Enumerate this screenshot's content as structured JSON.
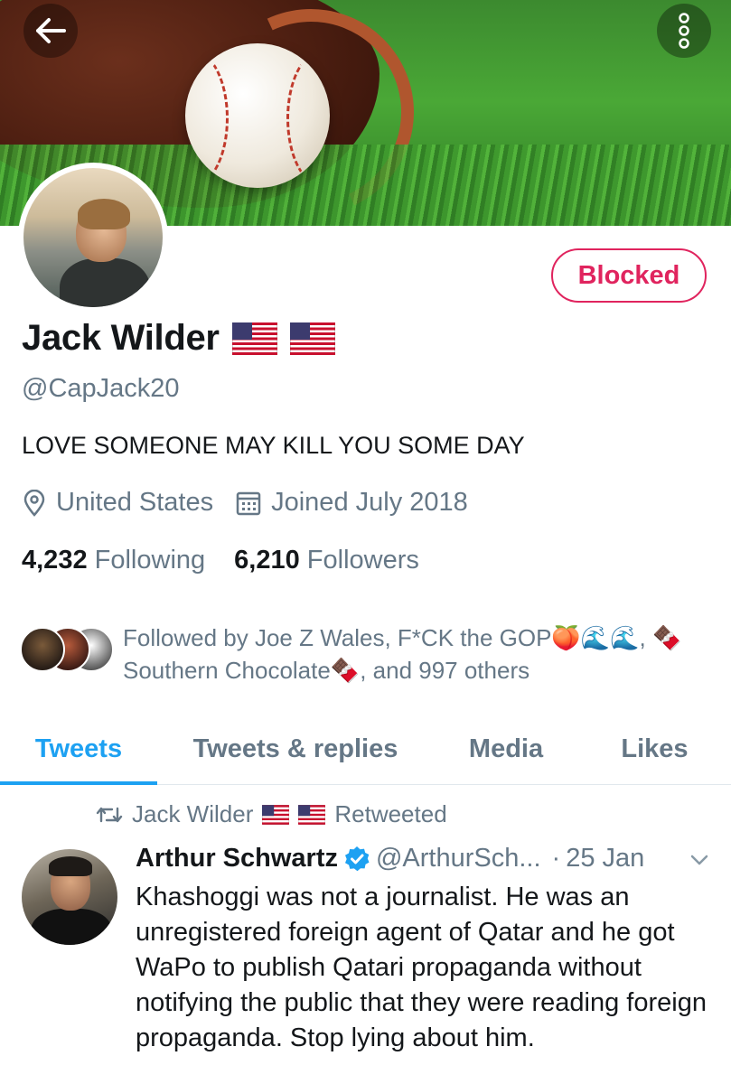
{
  "profile": {
    "name": "Jack Wilder",
    "handle": "@CapJack20",
    "bio": "LOVE SOMEONE MAY KILL YOU SOME DAY",
    "location": "United States",
    "joined": "Joined July 2018",
    "following_count": "4,232",
    "following_label": "Following",
    "followers_count": "6,210",
    "followers_label": "Followers",
    "blocked_label": "Blocked"
  },
  "followed_by": {
    "line1": "Followed by Joe Z Wales, F*CK the GOP🍑🌊🌊, 🍫",
    "line2": "Southern Chocolate🍫, and 997 others"
  },
  "tabs": [
    "Tweets",
    "Tweets & replies",
    "Media",
    "Likes"
  ],
  "retweet": {
    "name": "Jack Wilder",
    "label": "Retweeted"
  },
  "tweet": {
    "author": "Arthur Schwartz",
    "handle": "@ArthurSch...",
    "sep": "·",
    "date": "25 Jan",
    "text": "Khashoggi was not a journalist. He was an unregistered foreign agent of Qatar and he got WaPo to publish Qatari propaganda without notifying the public that they were reading foreign propaganda. Stop lying about him."
  },
  "icons": {
    "back": "arrow-left-icon",
    "more": "more-vertical-icon",
    "location": "location-pin-icon",
    "calendar": "calendar-icon",
    "retweet": "retweet-icon",
    "verified": "verified-badge-icon",
    "chevron": "chevron-down-icon"
  },
  "colors": {
    "accent": "#1da1f2",
    "blocked": "#e0245e",
    "secondary_text": "#657786"
  }
}
